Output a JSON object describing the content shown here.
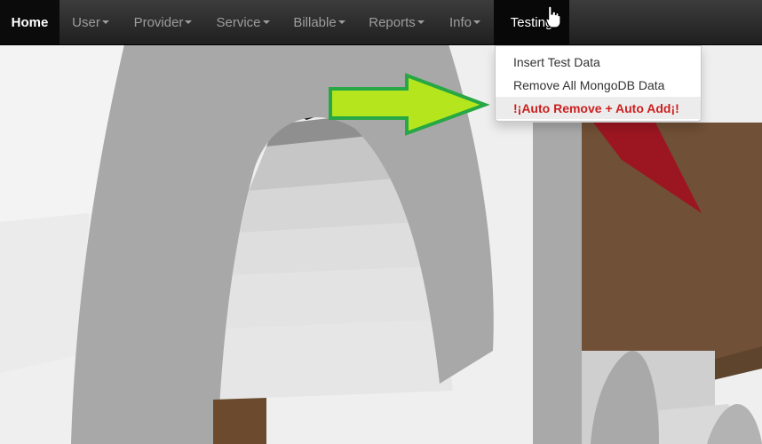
{
  "navbar": {
    "items": [
      {
        "label": "Home",
        "caret": false
      },
      {
        "label": "User",
        "caret": true
      },
      {
        "label": "Provider",
        "caret": true
      },
      {
        "label": "Service",
        "caret": true
      },
      {
        "label": "Billable",
        "caret": true
      },
      {
        "label": "Reports",
        "caret": true
      },
      {
        "label": "Info",
        "caret": true
      },
      {
        "label": "Testing",
        "caret": false
      }
    ]
  },
  "testing_menu": {
    "items": [
      {
        "label": "Insert Test Data"
      },
      {
        "label": "Remove All MongoDB Data"
      },
      {
        "label": "!¡Auto Remove + Auto Add¡!"
      }
    ]
  },
  "colors": {
    "navbar_bg": "#262626",
    "annotation_arrow": "#b5e61d",
    "highlight_text": "#cc1f1f"
  },
  "icons": [
    "hand-pointer-cursor-icon",
    "caret-down-icon",
    "annotation-arrow"
  ]
}
